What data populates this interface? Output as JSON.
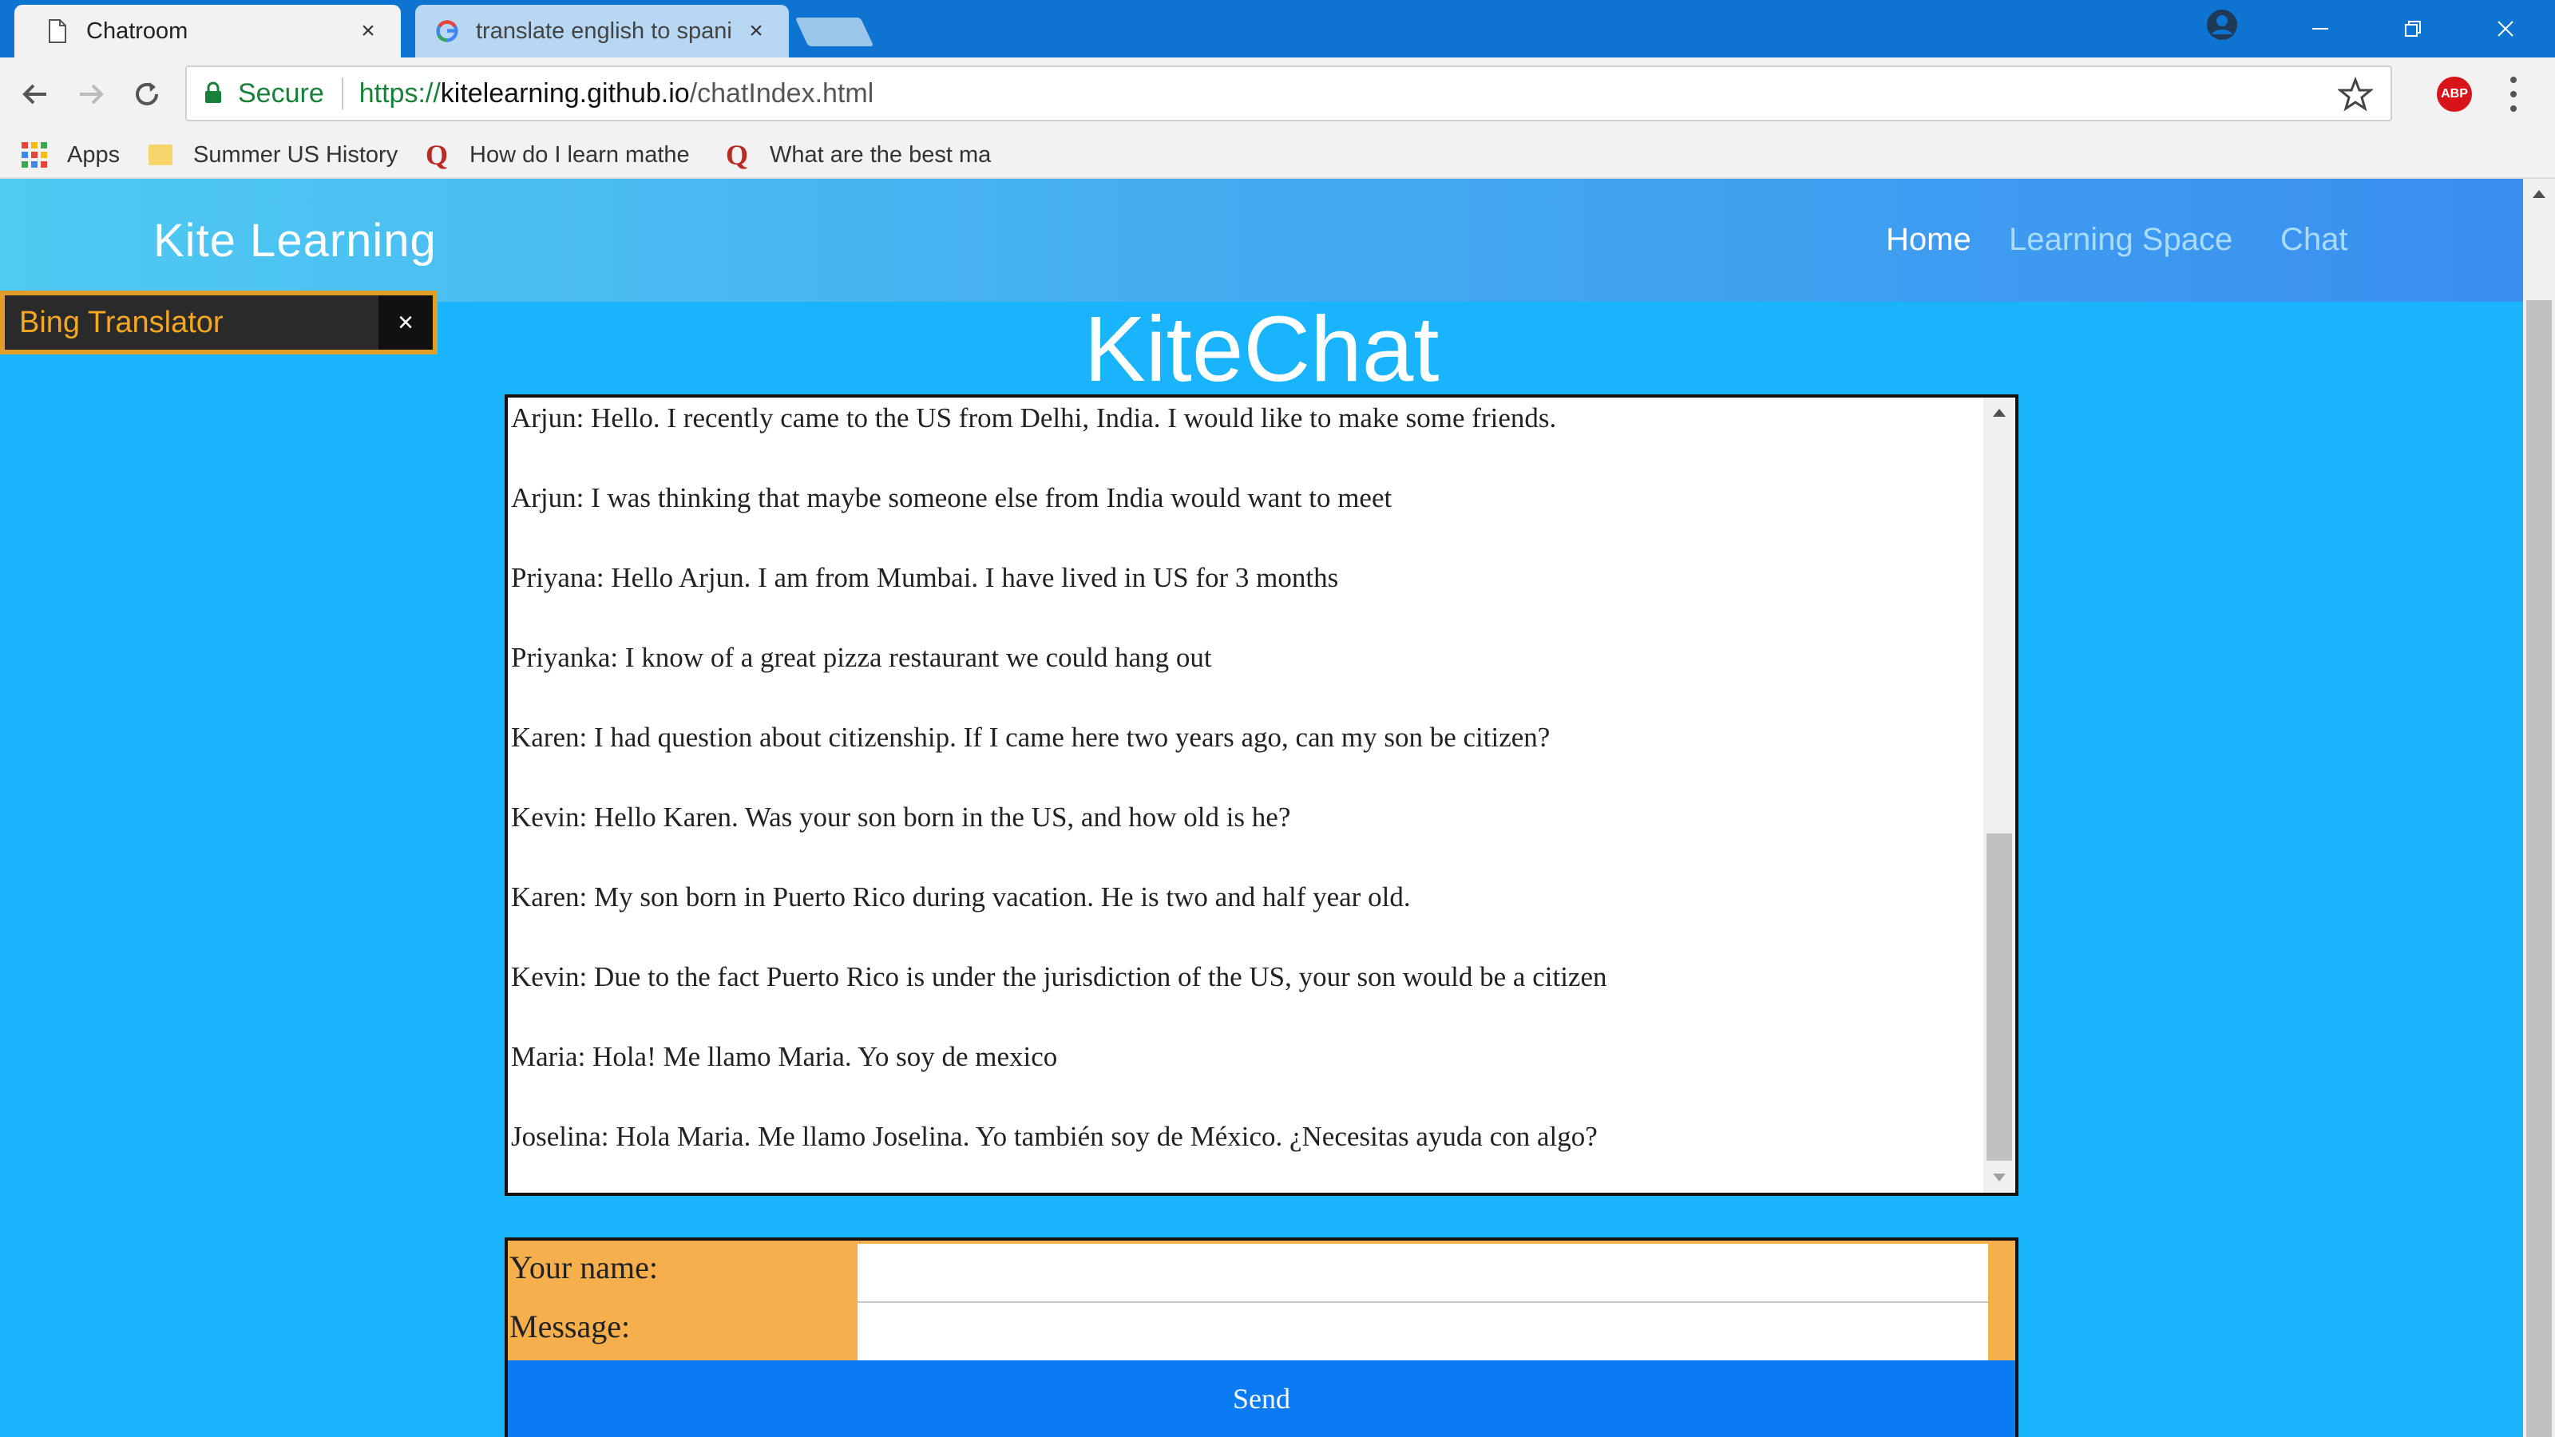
{
  "browser": {
    "tabs": [
      {
        "label": "Chatroom",
        "icon": "page-icon",
        "active": true
      },
      {
        "label": "translate english to spanish",
        "icon": "google-icon",
        "active": false
      }
    ],
    "omnibox": {
      "secure_label": "Secure",
      "url_protocol": "https://",
      "url_host": "kitelearning.github.io",
      "url_path": "/chatIndex.html"
    },
    "bookmarks": [
      {
        "label": "Apps",
        "icon": "apps-grid-icon"
      },
      {
        "label": "Summer US History",
        "icon": "folder-icon"
      },
      {
        "label": "How do I learn mathe",
        "icon": "quora-icon"
      },
      {
        "label": "What are the best ma",
        "icon": "quora-icon"
      }
    ],
    "extension_label": "ABP"
  },
  "site": {
    "brand": "Kite Learning",
    "nav": [
      {
        "label": "Home",
        "active": true
      },
      {
        "label": "Learning Space",
        "active": false
      },
      {
        "label": "Chat",
        "active": false
      }
    ]
  },
  "bing_translator": {
    "label": "Bing Translator",
    "close_glyph": "×"
  },
  "page_title": "KiteChat",
  "messages": [
    "Arjun: Hello. I recently came to the US from Delhi, India. I would like to make some friends.",
    "Arjun: I was thinking that maybe someone else from India would want to meet",
    "Priyana: Hello Arjun. I am from Mumbai. I have lived in US for 3 months",
    "Priyanka: I know of a great pizza restaurant we could hang out",
    "Karen: I had question about citizenship. If I came here two years ago, can my son be citizen?",
    "Kevin: Hello Karen. Was your son born in the US, and how old is he?",
    "Karen: My son born in Puerto Rico during vacation. He is two and half year old.",
    "Kevin: Due to the fact Puerto Rico is under the jurisdiction of the US, your son would be a citizen",
    "Maria: Hola! Me llamo Maria. Yo soy de mexico",
    "Joselina: Hola Maria. Me llamo Joselina. Yo también soy de México. ¿Necesitas ayuda con algo?"
  ],
  "form": {
    "name_label": "Your name:",
    "name_value": "",
    "message_label": "Message:",
    "message_value": "",
    "send_label": "Send"
  },
  "colors": {
    "page_bg": "#19b4fb",
    "form_bg": "#f5b04d",
    "send_button": "#0a7bf2",
    "titlebar": "#0d74d2"
  }
}
